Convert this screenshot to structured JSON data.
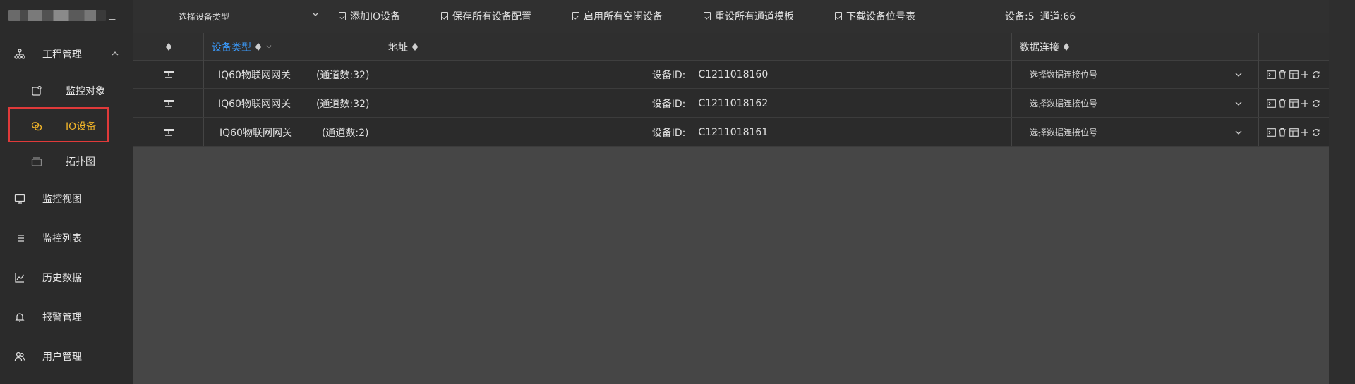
{
  "sidebar": {
    "caret": "▁",
    "items": [
      {
        "label": "工程管理",
        "icon": "sitemap-icon"
      },
      {
        "label": "监控对象",
        "icon": "monitor-object-icon"
      },
      {
        "label": "IO设备",
        "icon": "io-device-icon"
      },
      {
        "label": "拓扑图",
        "icon": "topology-icon"
      },
      {
        "label": "监控视图",
        "icon": "monitor-screen-icon"
      },
      {
        "label": "监控列表",
        "icon": "list-icon"
      },
      {
        "label": "历史数据",
        "icon": "line-chart-icon"
      },
      {
        "label": "报警管理",
        "icon": "bell-icon"
      },
      {
        "label": "用户管理",
        "icon": "users-icon"
      }
    ]
  },
  "toolbar": {
    "device_type_placeholder": "选择设备类型",
    "add_io": "添加IO设备",
    "save_all": "保存所有设备配置",
    "enable_idle": "启用所有空闲设备",
    "reset_templates": "重设所有通道模板",
    "download_table": "下载设备位号表",
    "stats_devices": "设备:5",
    "stats_channels": "通道:66"
  },
  "table": {
    "headers": {
      "device_type": "设备类型",
      "address": "地址",
      "data_connection": "数据连接"
    },
    "rows": [
      {
        "type": "IQ60物联网网关",
        "channels": "(通道数:32)",
        "id_label": "设备ID:",
        "id": "C1211018160",
        "conn": "选择数据连接位号"
      },
      {
        "type": "IQ60物联网网关",
        "channels": "(通道数:32)",
        "id_label": "设备ID:",
        "id": "C1211018162",
        "conn": "选择数据连接位号"
      },
      {
        "type": "IQ60物联网网关",
        "channels": "(通道数:2)",
        "id_label": "设备ID:",
        "id": "C1211018161",
        "conn": "选择数据连接位号"
      }
    ]
  },
  "colors": {
    "accent_active": "#f0b429",
    "header_blue": "#3b9cff",
    "highlight_red": "#e03a3a"
  }
}
